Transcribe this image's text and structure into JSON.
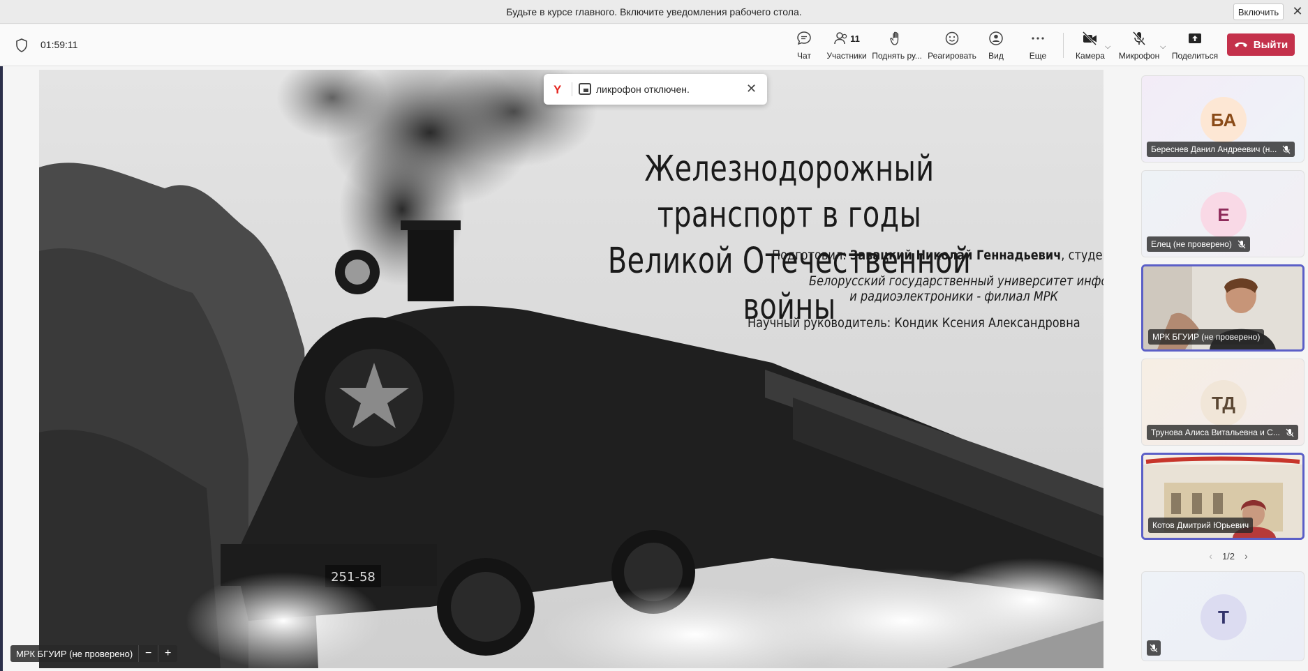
{
  "notification": {
    "text": "Будьте в курсе главного. Включите уведомления рабочего стола.",
    "enable_label": "Включить",
    "close_glyph": "✕"
  },
  "toolbar": {
    "timer": "01:59:11",
    "participants_count": "11",
    "items": {
      "chat": "Чат",
      "participants": "Участники",
      "raise_hand": "Поднять ру...",
      "react": "Реагировать",
      "view": "Вид",
      "more": "Еще",
      "camera": "Камера",
      "mic": "Микрофон",
      "share": "Поделиться"
    },
    "leave_label": "Выйти",
    "leave_color": "#c4314b"
  },
  "toast": {
    "y_glyph": "Y",
    "text": "ликрофон отключен.",
    "close_glyph": "✕"
  },
  "slide": {
    "title_line1": "Железнодорожный транспорт в годы",
    "title_line2": "Великой Отечественной войны",
    "prepared_prefix": "Подготовил: ",
    "prepared_name": "Завацкий Николай Геннадьевич",
    "prepared_suffix": ", студент",
    "university_line1": "Белорусский государственный университет информатики",
    "university_line2": "и       радиоэлектроники - филиал МРК",
    "advisor": "Научный руководитель: Кондик Ксения Александровна",
    "locomotive_number": "251-58"
  },
  "self_view": {
    "name": "МРК БГУИР (не проверено)",
    "zoom_out": "−",
    "zoom_in": "+"
  },
  "participants": [
    {
      "initials": "БА",
      "name": "Береснев Данил Андреевич (н...",
      "muted": true,
      "avatar_bg": "#fde7d4",
      "avatar_fg": "#8a4b18"
    },
    {
      "initials": "Е",
      "name": "Елец (не проверено)",
      "muted": true,
      "avatar_bg": "#f9d9e6",
      "avatar_fg": "#8e2b5a"
    },
    {
      "initials": "",
      "name": "МРК БГУИР (не проверено)",
      "muted": false,
      "video": true
    },
    {
      "initials": "ТД",
      "name": "Трунова Алиса Витальевна и С...",
      "muted": true,
      "avatar_bg": "#f1e6d8",
      "avatar_fg": "#5a4632"
    },
    {
      "initials": "",
      "name": "Котов Дмитрий Юрьевич",
      "muted": false,
      "video": true
    },
    {
      "initials": "Т",
      "name": "",
      "muted": true,
      "avatar_bg": "#dcdcf1",
      "avatar_fg": "#33346b"
    }
  ],
  "pager": {
    "text": "1/2"
  },
  "accent": "#5b5fc7"
}
